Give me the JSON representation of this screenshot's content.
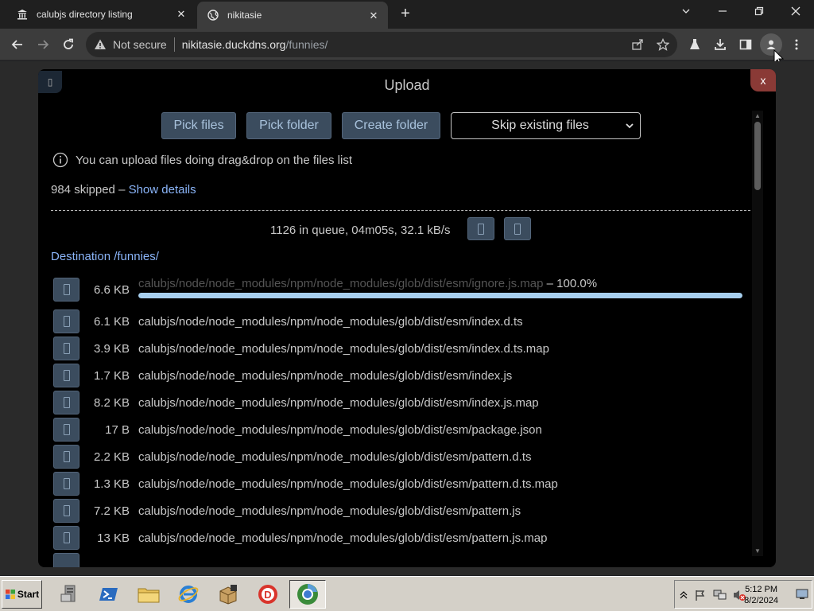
{
  "browser": {
    "tabs": [
      {
        "title": "calubjs directory listing",
        "active": false
      },
      {
        "title": "nikitasie",
        "active": true
      }
    ],
    "address": {
      "security": "Not secure",
      "host": "nikitasie.duckdns.org",
      "path": "/funnies/"
    }
  },
  "modal": {
    "title": "Upload",
    "close_label": "x",
    "buttons": {
      "pick_files": "Pick files",
      "pick_folder": "Pick folder",
      "create_folder": "Create folder"
    },
    "mode_select": "Skip existing files",
    "hint": "You can upload files doing drag&drop on the files list",
    "skipped_text": "984 skipped – ",
    "show_details": "Show details",
    "queue_status": "1126 in queue, 04m05s, 32.1 kB/s",
    "destination": "Destination /funnies/",
    "files": [
      {
        "size": "6.6 KB",
        "path": "calubjs/node/node_modules/npm/node_modules/glob/dist/esm/ignore.js.map",
        "progress_text": " – 100.0%",
        "progress": 1.0
      },
      {
        "size": "6.1 KB",
        "path": "calubjs/node/node_modules/npm/node_modules/glob/dist/esm/index.d.ts"
      },
      {
        "size": "3.9 KB",
        "path": "calubjs/node/node_modules/npm/node_modules/glob/dist/esm/index.d.ts.map"
      },
      {
        "size": "1.7 KB",
        "path": "calubjs/node/node_modules/npm/node_modules/glob/dist/esm/index.js"
      },
      {
        "size": "8.2 KB",
        "path": "calubjs/node/node_modules/npm/node_modules/glob/dist/esm/index.js.map"
      },
      {
        "size": "17 B",
        "path": "calubjs/node/node_modules/npm/node_modules/glob/dist/esm/package.json"
      },
      {
        "size": "2.2 KB",
        "path": "calubjs/node/node_modules/npm/node_modules/glob/dist/esm/pattern.d.ts"
      },
      {
        "size": "1.3 KB",
        "path": "calubjs/node/node_modules/npm/node_modules/glob/dist/esm/pattern.d.ts.map"
      },
      {
        "size": "7.2 KB",
        "path": "calubjs/node/node_modules/npm/node_modules/glob/dist/esm/pattern.js"
      },
      {
        "size": "13 KB",
        "path": "calubjs/node/node_modules/npm/node_modules/glob/dist/esm/pattern.js.map"
      }
    ]
  },
  "taskbar": {
    "start_label": "Start",
    "time": "5:12 PM",
    "date": "8/2/2024"
  }
}
